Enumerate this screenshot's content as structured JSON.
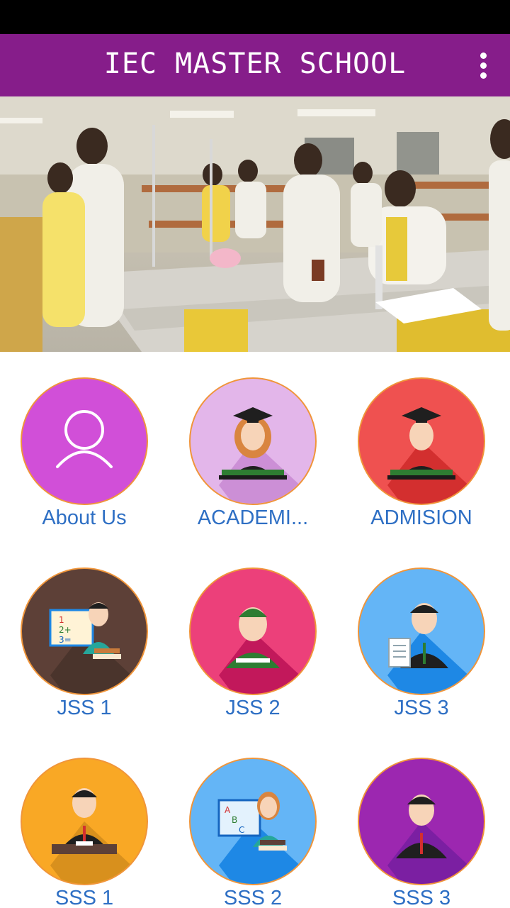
{
  "app_bar": {
    "title": "IEC MASTER SCHOOL",
    "menu_icon": "more-vert-icon"
  },
  "slider": {
    "slide_count": 3,
    "active_index": 2
  },
  "tiles": [
    {
      "label": "About Us",
      "icon": "person-outline-icon",
      "bg": "#d14fd8"
    },
    {
      "label": "ACADEMI...",
      "icon": "graduate-girl-icon",
      "bg": "#e3b6ea"
    },
    {
      "label": "ADMISION",
      "icon": "graduate-boy-icon",
      "bg": "#ef5150"
    },
    {
      "label": "JSS 1",
      "icon": "teacher-board-icon",
      "bg": "#5d4037"
    },
    {
      "label": "JSS 2",
      "icon": "student-icon",
      "bg": "#ec407a"
    },
    {
      "label": "JSS 3",
      "icon": "student-document-icon",
      "bg": "#64b5f6"
    },
    {
      "label": "SSS 1",
      "icon": "student-desk-icon",
      "bg": "#f9a825"
    },
    {
      "label": "SSS 2",
      "icon": "teacher-abc-icon",
      "bg": "#64b5f6"
    },
    {
      "label": "SSS 3",
      "icon": "student-suit-icon",
      "bg": "#9c27b0"
    }
  ],
  "colors": {
    "app_bar": "#861d8a",
    "label": "#2e6fc4",
    "ring": "#f0953a"
  }
}
